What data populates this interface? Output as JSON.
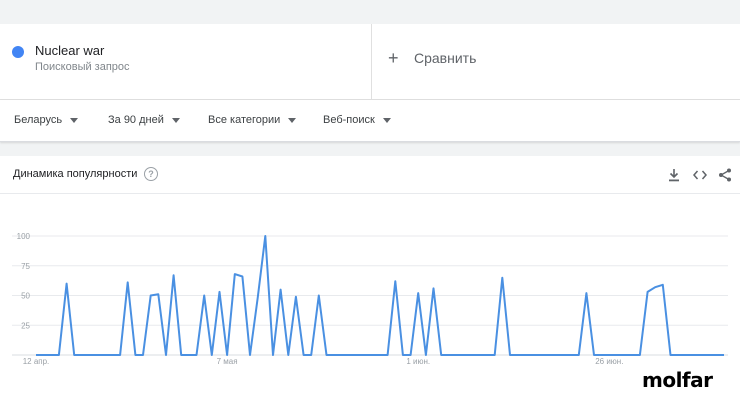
{
  "term": {
    "name": "Nuclear war",
    "subtitle": "Поисковый запрос",
    "color": "#4285f4"
  },
  "compare": {
    "label": "Сравнить",
    "icon": "plus-icon"
  },
  "filters": [
    {
      "label": "Беларусь"
    },
    {
      "label": "За 90 дней"
    },
    {
      "label": "Все категории"
    },
    {
      "label": "Веб-поиск"
    }
  ],
  "panel": {
    "title": "Динамика популярности",
    "help_icon": "?",
    "icons": [
      "download-icon",
      "embed-icon",
      "share-icon"
    ]
  },
  "chart_data": {
    "type": "line",
    "title": "",
    "xlabel": "",
    "ylabel": "",
    "ylim": [
      0,
      100
    ],
    "yticks": [
      25,
      50,
      75,
      100
    ],
    "xtick_labels": [
      {
        "label": "12 апр.",
        "index": 0
      },
      {
        "label": "7 мая",
        "index": 25
      },
      {
        "label": "1 июн.",
        "index": 50
      },
      {
        "label": "26 июн.",
        "index": 75
      }
    ],
    "series": [
      {
        "color": "#4a90e2",
        "values": [
          0,
          0,
          0,
          0,
          60,
          0,
          0,
          0,
          0,
          0,
          0,
          0,
          61,
          0,
          0,
          50,
          51,
          0,
          67,
          0,
          0,
          0,
          50,
          0,
          53,
          0,
          68,
          66,
          0,
          48,
          100,
          0,
          55,
          0,
          49,
          0,
          0,
          50,
          0,
          0,
          0,
          0,
          0,
          0,
          0,
          0,
          0,
          62,
          0,
          0,
          52,
          0,
          56,
          0,
          0,
          0,
          0,
          0,
          0,
          0,
          0,
          65,
          0,
          0,
          0,
          0,
          0,
          0,
          0,
          0,
          0,
          0,
          52,
          0,
          0,
          0,
          0,
          0,
          0,
          0,
          53,
          57,
          59,
          0,
          0,
          0,
          0,
          0,
          0,
          0,
          0
        ]
      }
    ]
  },
  "brand": {
    "logo_text": "molfar"
  }
}
